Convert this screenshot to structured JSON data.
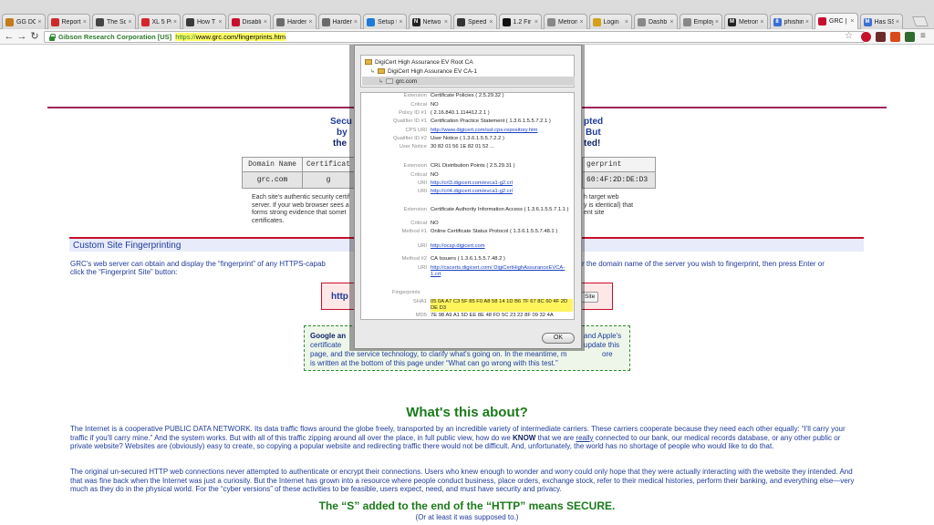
{
  "tabs": [
    {
      "label": "GG DO",
      "fav_color": "#c47b18",
      "fav_text": ""
    },
    {
      "label": "Report",
      "fav_color": "#cc2b2b",
      "fav_text": ""
    },
    {
      "label": "The Sc",
      "fav_color": "#444444",
      "fav_text": ""
    },
    {
      "label": "XL 5 Princ",
      "fav_color": "#d6262d",
      "fav_text": ""
    },
    {
      "label": "How T",
      "fav_color": "#3a3a3a",
      "fav_text": ""
    },
    {
      "label": "Disabli",
      "fav_color": "#c8102e",
      "fav_text": ""
    },
    {
      "label": "Harder",
      "fav_color": "#6b6b6b",
      "fav_text": ""
    },
    {
      "label": "Harder",
      "fav_color": "#6b6b6b",
      "fav_text": ""
    },
    {
      "label": "Setup t",
      "fav_color": "#1e7ad6",
      "fav_text": ""
    },
    {
      "label": "Netwo",
      "fav_color": "#222222",
      "fav_text": "N"
    },
    {
      "label": "Speed",
      "fav_color": "#333333",
      "fav_text": ""
    },
    {
      "label": "1.2 Fir",
      "fav_color": "#111111",
      "fav_text": ""
    },
    {
      "label": "Metron",
      "fav_color": "#888888",
      "fav_text": ""
    },
    {
      "label": "Login",
      "fav_color": "#d4a017",
      "fav_text": ""
    },
    {
      "label": "Dashb",
      "fav_color": "#888888",
      "fav_text": ""
    },
    {
      "label": "Employ",
      "fav_color": "#888888",
      "fav_text": ""
    },
    {
      "label": "Metron",
      "fav_color": "#222222",
      "fav_text": "M"
    },
    {
      "label": "phishin",
      "fav_color": "#3b6fd8",
      "fav_text": "8"
    },
    {
      "label": "GRC | I",
      "fav_color": "#c8102e",
      "fav_text": "",
      "active": true
    },
    {
      "label": "Has SS",
      "fav_color": "#3b6fd8",
      "fav_text": "M"
    }
  ],
  "toolbar": {
    "back_icon": "←",
    "forward_icon": "→",
    "reload_icon": "↻",
    "ev_name": "Gibson Research Corporation [US]",
    "url_scheme": "https://",
    "url_rest": "www.grc.com/fingerprints.htm"
  },
  "page": {
    "header_left": [
      "Secu",
      "by",
      "the"
    ],
    "header_right": [
      "pted",
      "But",
      "ted!"
    ],
    "table": {
      "col1_header": "Domain Name",
      "col2_header": "Certificat",
      "col3_header": "gerprint",
      "col1_value": "grc.com",
      "col2_value": "g",
      "col3_value": "60:4F:2D:DE:D3"
    },
    "small_left_lines": [
      "Each site's authentic security certif",
      "server. If your web browser sees a",
      "forms strong evidence that somet",
      "certificates."
    ],
    "small_left_link1": "If your web browser sees a",
    "small_right_lines": [
      "h target web",
      "y is identical) that",
      "ent site"
    ],
    "section_title": "Custom Site Fingerprinting",
    "intro_left_1": "GRC's web server can obtain and display the “fingerprint” of any HTTPS-capab",
    "intro_left_2": "click the “Fingerprint Site” button:",
    "intro_right_1": "r the domain name of the server you wish to fingerprint, then press Enter or",
    "http_label": "http",
    "site_button": "Site",
    "note_left_bold": "Google an",
    "note_right_1": "and Apple's",
    "note_right_2": "update this",
    "note_right_3": "ore",
    "note_left_2": "certificate",
    "note_left_3": "page, and the service technology, to clarify what's going on. In the meantime, m",
    "note_left_4": "is written at the bottom of this page under “What can go wrong with this test.”",
    "whats_heading": "What's this about?",
    "para1": "The Internet is a cooperative PUBLIC DATA NETWORK. Its data traffic flows around the globe freely, transported by an incredible variety of intermediate carriers. These carriers cooperate because they need each other equally: “I'll carry your traffic if you'll carry mine.” And the system works. But with all of this traffic zipping around all over the place, in full public view, how do we",
    "para1_bold": "KNOW",
    "para1_mid": "that we are",
    "para1_link": "really",
    "para1_end": "connected to our bank, our medical records database, or any other public or private website? Websites are (obviously) easy to create, so copying a popular website and redirecting traffic there would not be difficult. And, unfortunately, the world has no shortage of people who would like to do that.",
    "para2": "The original un-secured HTTP web connections never attempted to authenticate or encrypt their connections. Users who knew enough to wonder and worry could only hope that they were actually interacting with the website they intended. And that was fine back when the Internet was just a curiosity. But the Internet has grown into a resource where people conduct business, place orders, exchange stock, refer to their medical histories, perform their banking, and everything else—very much as they do in the physical world. For the “cyber versions” of these activities to be feasible, users expect, need, and must have security and privacy.",
    "secure_heading": "The “S” added to the end of the “HTTP” means SECURE.",
    "secure_sub": "(Or at least it was supposed to.)"
  },
  "modal": {
    "tree": [
      "DigiCert High Assurance EV Root CA",
      "DigiCert High Assurance EV CA-1",
      "grc.com"
    ],
    "rows": [
      {
        "k": "Extension",
        "v": "Certificate Policies ( 2.5.29.32 )"
      },
      {
        "k": "Critical",
        "v": "NO"
      },
      {
        "k": "Policy ID #1",
        "v": "( 2.16.840.1.114412.2.1 )"
      },
      {
        "k": "Qualifier ID #1",
        "v": "Certification Practice Statement ( 1.3.6.1.5.5.7.2.1 )"
      },
      {
        "k": "CPS URI",
        "v": "http://www.digicert.com/ssl-cps-repository.htm",
        "link": true
      },
      {
        "k": "Qualifier ID #2",
        "v": "User Notice ( 1.3.6.1.5.5.7.2.2 )"
      },
      {
        "k": "User Notice",
        "v": "30 82 01 56 1E 82 01 52 ..."
      },
      {
        "k": "Extension",
        "v": "CRL Distribution Points ( 2.5.29.31 )"
      },
      {
        "k": "Critical",
        "v": "NO"
      },
      {
        "k": "URI",
        "v": "http://crl3.digicert.com/evca1-g2.crl",
        "link": true
      },
      {
        "k": "URI",
        "v": "http://crl4.digicert.com/evca1-g2.crl",
        "link": true
      },
      {
        "k": "Extension",
        "v": "Certificate Authority Information Access ( 1.3.6.1.5.5.7.1.1 )"
      },
      {
        "k": "Critical",
        "v": "NO"
      },
      {
        "k": "Method #1",
        "v": "Online Certificate Status Protocol ( 1.3.6.1.5.5.7.48.1 )"
      },
      {
        "k": "URI",
        "v": "http://ocsp.digicert.com",
        "link": true
      },
      {
        "k": "Method #2",
        "v": "CA Issuers ( 1.3.6.1.5.5.7.48.2 )"
      },
      {
        "k": "URI",
        "v": "http://cacerts.digicert.com/ DigiCertHighAssuranceEVCA-1.crt",
        "link": true
      },
      {
        "k": "SHA1",
        "v": "05 0A A7 C3 5F 85 F0 A8 58 14 1D B6 7F 67 8C 60 4F 2D DE D3",
        "hl": true
      },
      {
        "k": "MD5",
        "v": "7E 98 A9 A1 5D EE 8E 48 FD 5C 23 22 8F 09 32 4A"
      }
    ],
    "fingerprints_label": "Fingerprints",
    "ok_label": "OK"
  }
}
